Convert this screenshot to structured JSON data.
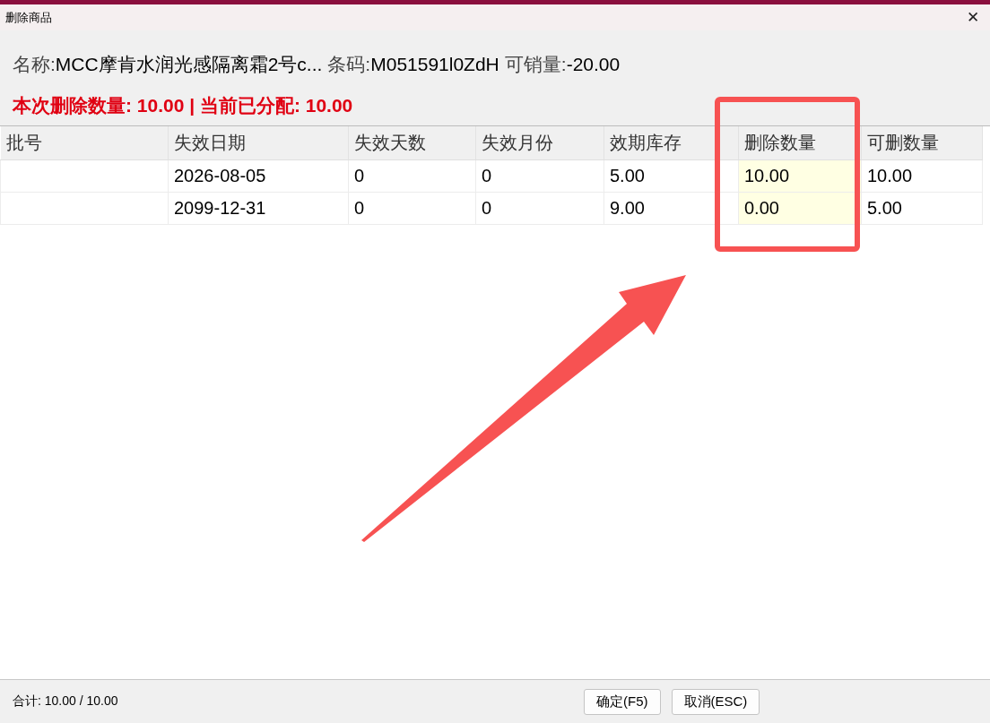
{
  "window": {
    "title": "删除商品",
    "close": "✕"
  },
  "info": [
    {
      "label": "名称:",
      "value": "MCC摩肯水润光感隔离霜2号c..."
    },
    {
      "label": "条码:",
      "value": "M051591l0ZdH"
    },
    {
      "label": "可销量:",
      "value": "-20.00"
    }
  ],
  "summary": "本次删除数量: 10.00 | 当前已分配: 10.00",
  "table": {
    "columns": [
      {
        "label": "批号",
        "editable": false
      },
      {
        "label": "失效日期",
        "editable": false
      },
      {
        "label": "失效天数",
        "editable": false
      },
      {
        "label": "失效月份",
        "editable": false
      },
      {
        "label": "效期库存",
        "editable": false
      },
      {
        "label": "删除数量",
        "editable": true
      },
      {
        "label": "可删数量",
        "editable": false
      }
    ],
    "rows": [
      [
        "",
        "2026-08-05",
        "0",
        "0",
        "5.00",
        "10.00",
        "10.00"
      ],
      [
        "",
        "2099-12-31",
        "0",
        "0",
        "9.00",
        "0.00",
        "5.00"
      ]
    ]
  },
  "status_bar": {
    "total": "合计: 10.00 / 10.00",
    "buttons": [
      "确定(F5)",
      "取消(ESC)"
    ]
  }
}
